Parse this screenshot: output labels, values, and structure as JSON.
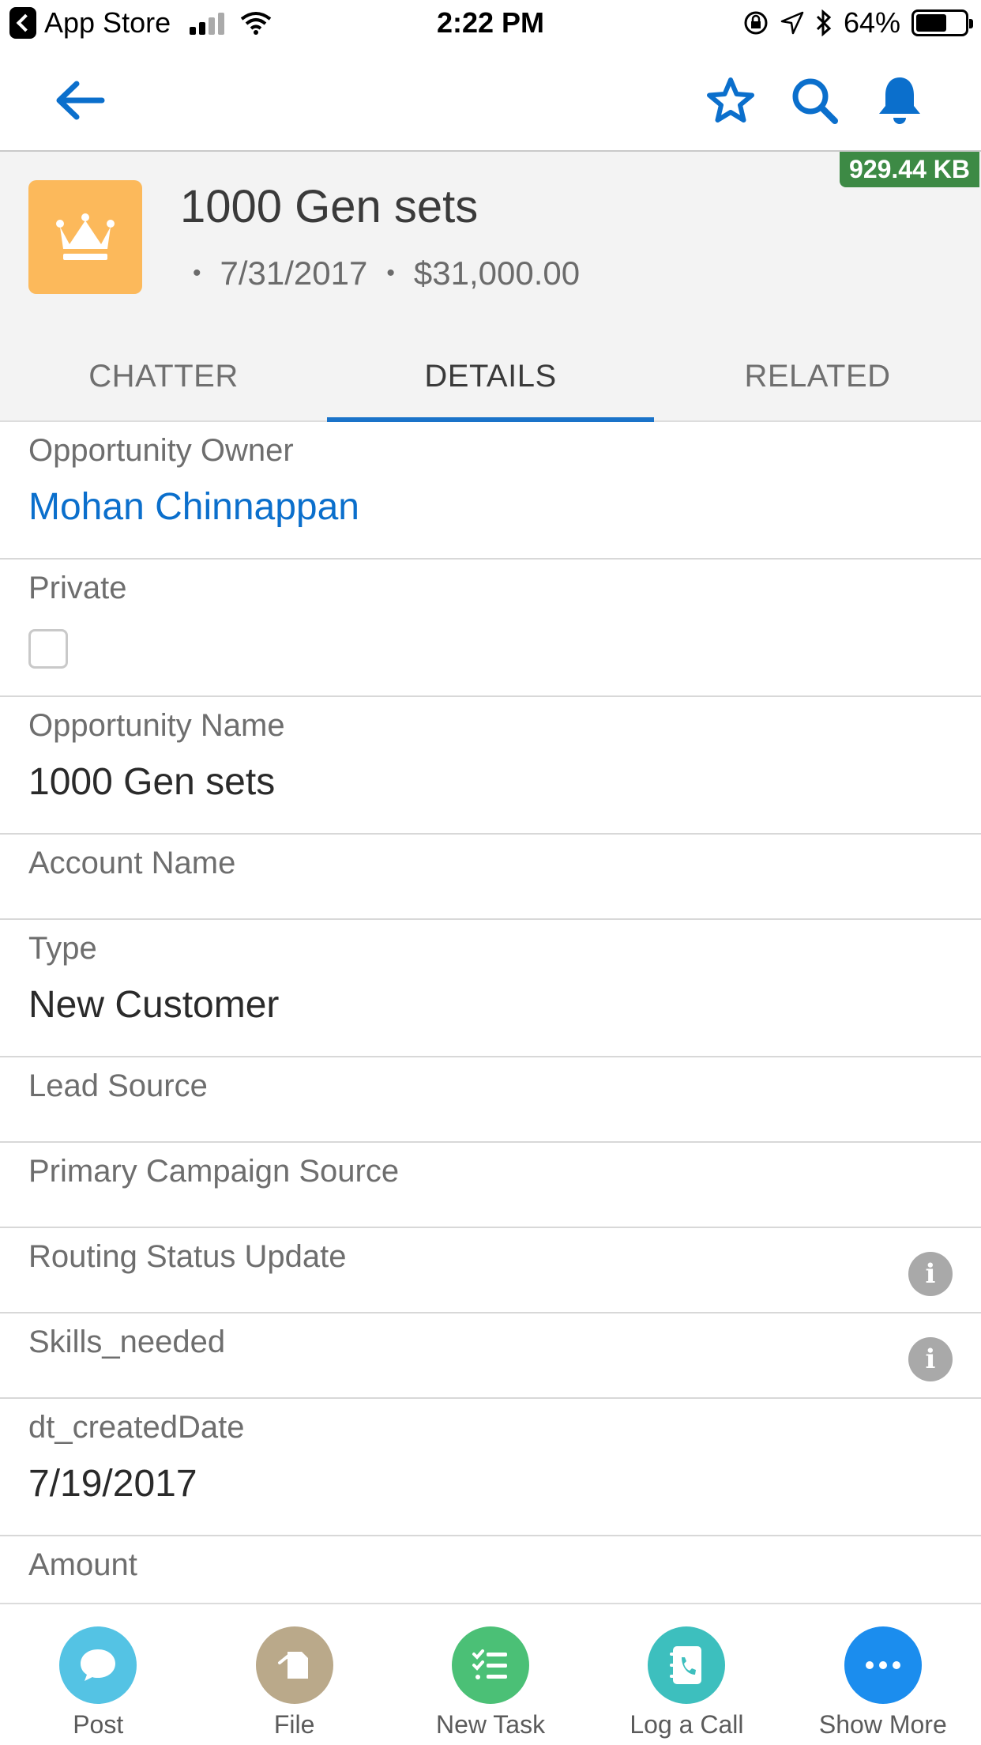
{
  "status_bar": {
    "back_label": "App Store",
    "time": "2:22 PM",
    "battery": "64%",
    "battery_level": 0.64
  },
  "nav": {
    "icons": [
      "arrow-left-icon",
      "star-icon",
      "search-icon",
      "bell-icon"
    ]
  },
  "record": {
    "size_badge": "929.44 KB",
    "title": "1000 Gen sets",
    "close_date": "7/31/2017",
    "amount": "$31,000.00",
    "icon": "crown-icon",
    "icon_color": "#fcb95b"
  },
  "tabs": [
    {
      "label": "CHATTER"
    },
    {
      "label": "DETAILS"
    },
    {
      "label": "RELATED"
    }
  ],
  "fields": [
    {
      "label": "Opportunity Owner",
      "value": "Mohan Chinnappan"
    },
    {
      "label": "Private",
      "checked": false
    },
    {
      "label": "Opportunity Name",
      "value": "1000 Gen sets"
    },
    {
      "label": "Account Name",
      "value": ""
    },
    {
      "label": "Type",
      "value": "New Customer"
    },
    {
      "label": "Lead Source",
      "value": ""
    },
    {
      "label": "Primary Campaign Source",
      "value": ""
    },
    {
      "label": "Routing Status Update",
      "value": ""
    },
    {
      "label": "Skills_needed",
      "value": ""
    },
    {
      "label": "dt_createdDate",
      "value": "7/19/2017"
    },
    {
      "label": "Amount",
      "value": ""
    }
  ],
  "actions": [
    {
      "label": "Post",
      "icon": "chat-bubble-icon",
      "color": "#54c3e4"
    },
    {
      "label": "File",
      "icon": "file-icon",
      "color": "#baa98a"
    },
    {
      "label": "New Task",
      "icon": "task-list-icon",
      "color": "#4bc076"
    },
    {
      "label": "Log a Call",
      "icon": "phone-log-icon",
      "color": "#3dbfbe"
    },
    {
      "label": "Show More",
      "icon": "more-icon",
      "color": "#1b8dee"
    }
  ],
  "colors": {
    "brand_blue": "#0b6fcc",
    "tab_indicator": "#1a73c9",
    "badge_green": "#3d8a45"
  }
}
